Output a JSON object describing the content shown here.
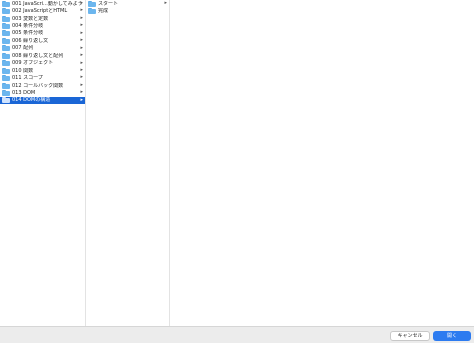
{
  "columns": {
    "first": [
      {
        "label": "001 JavaScri...動かしてみよう",
        "selected": false
      },
      {
        "label": "002 JavaScriptとHTML",
        "selected": false
      },
      {
        "label": "003 変数と定数",
        "selected": false
      },
      {
        "label": "004 条件分岐",
        "selected": false
      },
      {
        "label": "005 条件分岐",
        "selected": false
      },
      {
        "label": "006 繰り返し文",
        "selected": false
      },
      {
        "label": "007 配列",
        "selected": false
      },
      {
        "label": "008 繰り返し文と配列",
        "selected": false
      },
      {
        "label": "009 オブジェクト",
        "selected": false
      },
      {
        "label": "010 関数",
        "selected": false
      },
      {
        "label": "011 スコープ",
        "selected": false
      },
      {
        "label": "012 コールバック関数",
        "selected": false
      },
      {
        "label": "013 DOM",
        "selected": false
      },
      {
        "label": "014 DOMの構造",
        "selected": true
      }
    ],
    "second": [
      {
        "label": "スタート",
        "has_children": true
      },
      {
        "label": "完成",
        "has_children": false
      }
    ]
  },
  "icons": {
    "folder": "folder-icon",
    "disclosure": "chevron-right-icon",
    "disclosure_glyph": "▸"
  },
  "colors": {
    "selection": "#1a66d6",
    "folder": "#6cb6ee",
    "primary_button": "#2c7bf0"
  },
  "footer": {
    "cancel_label": "キャンセル",
    "open_label": "開く"
  }
}
